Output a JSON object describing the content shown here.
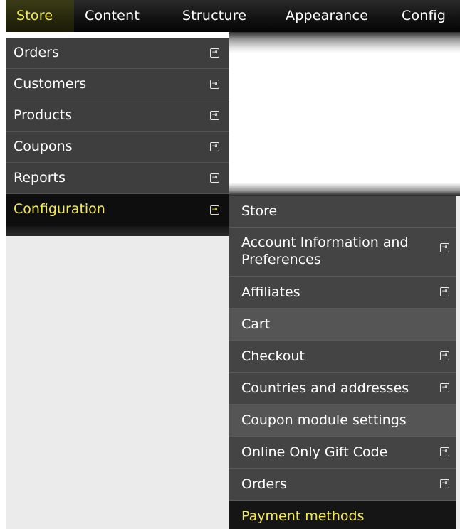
{
  "topbar": {
    "items": [
      {
        "label": "Store",
        "active": true
      },
      {
        "label": "Content",
        "active": false
      },
      {
        "label": "Structure",
        "active": false
      },
      {
        "label": "Appearance",
        "active": false
      },
      {
        "label": "Config",
        "active": false
      }
    ]
  },
  "store_menu": {
    "items": [
      {
        "label": "Orders",
        "icon": "submenu-arrow-icon"
      },
      {
        "label": "Customers",
        "icon": "submenu-arrow-icon"
      },
      {
        "label": "Products",
        "icon": "submenu-arrow-icon"
      },
      {
        "label": "Coupons",
        "icon": "submenu-arrow-icon"
      },
      {
        "label": "Reports",
        "icon": "submenu-arrow-icon"
      },
      {
        "label": "Configuration",
        "icon": "submenu-arrow-icon",
        "selected": true
      }
    ]
  },
  "configuration_menu": {
    "items": [
      {
        "label": "Store",
        "has_submenu": false
      },
      {
        "label": "Account Information and Preferences",
        "has_submenu": true
      },
      {
        "label": "Affiliates",
        "has_submenu": true
      },
      {
        "label": "Cart",
        "has_submenu": false
      },
      {
        "label": "Checkout",
        "has_submenu": true
      },
      {
        "label": "Countries and addresses",
        "has_submenu": true
      },
      {
        "label": "Coupon module settings",
        "has_submenu": false
      },
      {
        "label": "Online Only Gift Code",
        "has_submenu": true
      },
      {
        "label": "Orders",
        "has_submenu": true
      },
      {
        "label": "Payment methods",
        "has_submenu": false,
        "hovered": true
      }
    ]
  },
  "icons": {
    "submenu_arrow": "⇥"
  },
  "colors": {
    "active_text": "#f2ea52",
    "menu_bg": "#3e3e3e",
    "selected_bg": "#0e0e0e",
    "content_bg": "#ebebeb"
  }
}
